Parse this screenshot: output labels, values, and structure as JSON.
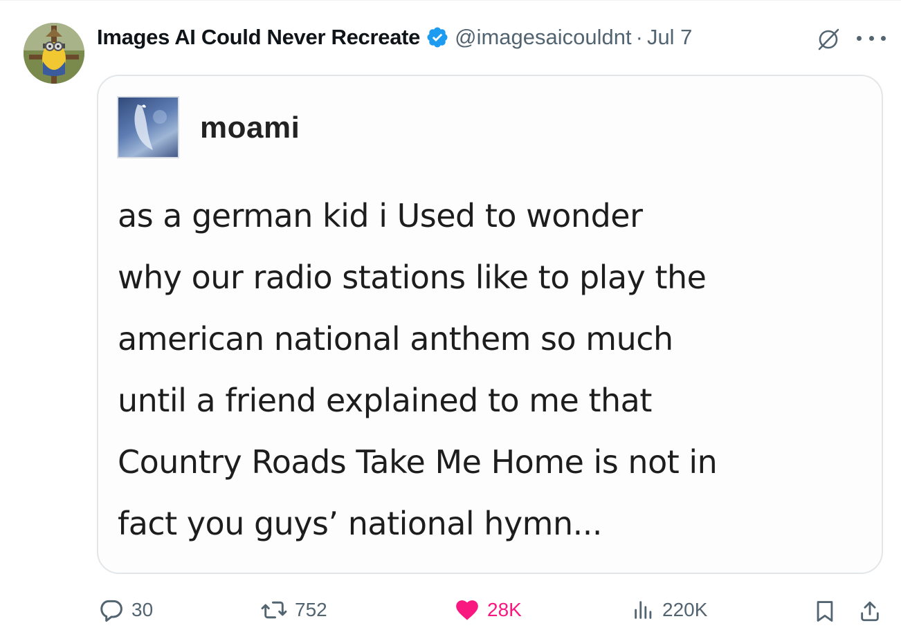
{
  "post": {
    "display_name": "Images AI Could Never Recreate",
    "verified_icon": "verified-badge-icon",
    "handle": "@imagesaicouldnt",
    "separator": "·",
    "date": "Jul 7"
  },
  "quoted_post": {
    "author": "moami",
    "lines": [
      "as a german kid i Used to wonder",
      "why our radio stations like to play the",
      "american national anthem so much",
      "until a friend explained to me that",
      "Country Roads Take Me Home is not in",
      "fact you guys’ national hymn..."
    ]
  },
  "actions": {
    "reply_count": "30",
    "repost_count": "752",
    "like_count": "28K",
    "view_count": "220K"
  },
  "colors": {
    "text_primary": "#0f1419",
    "text_secondary": "#536471",
    "verified_blue": "#1d9bf0",
    "like_pink": "#f91880",
    "card_border": "#e2e6e9"
  }
}
